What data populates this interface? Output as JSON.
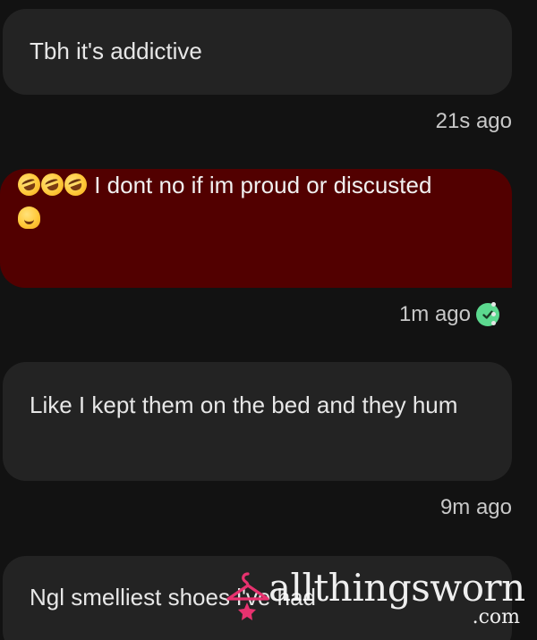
{
  "messages": [
    {
      "text": "Tbh it's addictive",
      "time": "21s ago"
    },
    {
      "emojis": [
        "rofl-emoji",
        "rofl-emoji",
        "rofl-emoji"
      ],
      "text": "I dont no if im proud or discusted",
      "trailing_emoji": "melting-face-emoji",
      "time": "1m ago",
      "status": "read",
      "colors": {
        "bubble": "#520000",
        "check": "#5cd98f"
      }
    },
    {
      "text": "Like I kept them on the bed and they hum",
      "time": "9m ago"
    },
    {
      "text": "Ngl smelliest shoes i've had"
    }
  ],
  "watermark": {
    "name": "allthingsworn",
    "domain": ".com",
    "accent": "#e7326f"
  },
  "theme": {
    "background": "#121212",
    "received_bubble": "#232323"
  }
}
